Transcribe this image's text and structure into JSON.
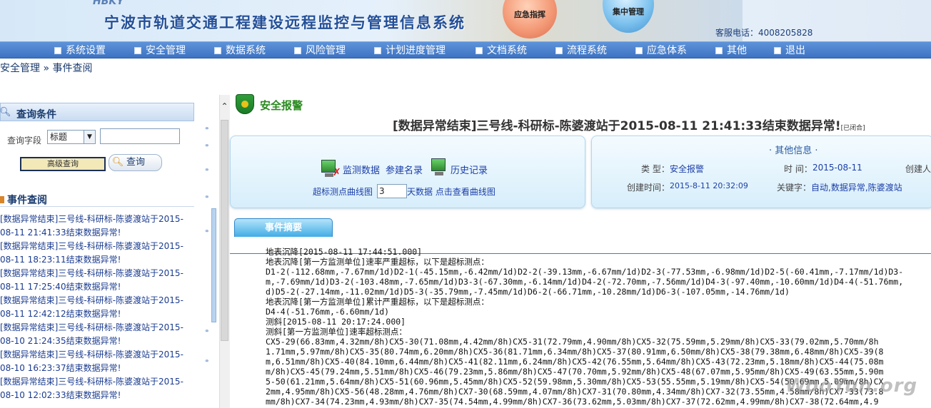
{
  "header": {
    "logo_text": "HBKY",
    "title": "宁波市轨道交通工程建设远程监控与管理信息系统",
    "orb_emergency": "应急指挥",
    "orb_central": "集中管理",
    "hotline": "客服电话：4008205828"
  },
  "nav": [
    "系统设置",
    "安全管理",
    "数据系统",
    "风险管理",
    "计划进度管理",
    "文档系统",
    "流程系统",
    "应急体系",
    "其他",
    "退出"
  ],
  "breadcrumb": "安全管理 » 事件查阅",
  "query": {
    "title": "查询条件",
    "field_label": "查询字段",
    "field_value": "标题",
    "advanced_label": "高级查询",
    "search_label": "查询"
  },
  "events": {
    "title": "事件查阅",
    "items": [
      "[数据异常结束]三号线-科研标-陈婆渡站于2015-08-11 21:41:33结束数据异常!",
      "[数据异常结束]三号线-科研标-陈婆渡站于2015-08-11 18:23:11结束数据异常!",
      "[数据异常结束]三号线-科研标-陈婆渡站于2015-08-11 17:25:40结束数据异常!",
      "[数据异常结束]三号线-科研标-陈婆渡站于2015-08-11 12:42:12结束数据异常!",
      "[数据异常结束]三号线-科研标-陈婆渡站于2015-08-10 21:24:35结束数据异常!",
      "[数据异常结束]三号线-科研标-陈婆渡站于2015-08-10 16:23:37结束数据异常!",
      "[数据异常结束]三号线-科研标-陈婆渡站于2015-08-10 12:02:33结束数据异常!"
    ]
  },
  "alarm": {
    "label": "安全报警",
    "title": "[数据异常结束]三号线-科研标-陈婆渡站于2015-08-11 21:41:33结束数据异常!",
    "closed_tag": "[已闭合]",
    "links": {
      "monitor": "监测数据",
      "params": "参建名录",
      "history": "历史记录",
      "curve": "超标测点曲线图",
      "days": "3",
      "days_suffix": "天数据 点击查看曲线图"
    },
    "other": {
      "title": "· 其他信息 ·",
      "type_label": "类 型：",
      "type_value": "安全报警",
      "time_label": "时 间：",
      "time_value": "2015-08-11",
      "creator_label": "创建人",
      "created_label": "创建时间：",
      "created_value": "2015-8-11 20:32:09",
      "keywords_label": "关键字：",
      "keywords_value": "自动,数据异常,陈婆渡站"
    }
  },
  "tab": {
    "label": "事件摘要"
  },
  "summary": [
    "地表沉降[2015-08-11 17:44:51.000]",
    "地表沉降[第一方监测单位]速率严重超标，以下是超标测点：",
    "D1-2(-112.68mm,-7.67mm/1d)D2-1(-45.15mm,-6.42mm/1d)D2-2(-39.13mm,-6.67mm/1d)D2-3(-77.53mm,-6.98mm/1d)D2-5(-60.41mm,-7.17mm/1d)D3-",
    "m,-7.69mm/1d)D3-2(-103.48mm,-7.65mm/1d)D3-3(-67.30mm,-6.14mm/1d)D4-2(-72.70mm,-7.56mm/1d)D4-3(-97.40mm,-10.60mm/1d)D4-4(-51.76mm,",
    "d)D5-2(-27.14mm,-11.02mm/1d)D5-3(-35.79mm,-7.45mm/1d)D6-2(-66.71mm,-10.28mm/1d)D6-3(-107.05mm,-14.76mm/1d)",
    "地表沉降[第一方监测单位]累计严重超标，以下是超标测点：",
    "D4-4(-51.76mm,-6.60mm/1d)",
    "测斜[2015-08-11 20:17:24.000]",
    "测斜[第一方监测单位]速率超标测点：",
    "CX5-29(66.83mm,4.32mm/8h)CX5-30(71.08mm,4.42mm/8h)CX5-31(72.79mm,4.90mm/8h)CX5-32(75.59mm,5.29mm/8h)CX5-33(79.02mm,5.70mm/8h",
    "1.71mm,5.97mm/8h)CX5-35(80.74mm,6.20mm/8h)CX5-36(81.71mm,6.34mm/8h)CX5-37(80.91mm,6.50mm/8h)CX5-38(79.38mm,6.48mm/8h)CX5-39(8",
    "m,6.51mm/8h)CX5-40(84.10mm,6.44mm/8h)CX5-41(82.11mm,6.24mm/8h)CX5-42(76.55mm,5.64mm/8h)CX5-43(72.23mm,5.18mm/8h)CX5-44(75.08m",
    "m/8h)CX5-45(79.24mm,5.51mm/8h)CX5-46(79.23mm,5.86mm/8h)CX5-47(70.70mm,5.92mm/8h)CX5-48(67.07mm,5.95mm/8h)CX5-49(63.55mm,5.90m",
    "5-50(61.21mm,5.64mm/8h)CX5-51(60.96mm,5.45mm/8h)CX5-52(59.98mm,5.30mm/8h)CX5-53(55.55mm,5.19mm/8h)CX5-54(50.69mm,5.09mm/8h)CX",
    "2mm,4.95mm/8h)CX5-56(48.28mm,4.76mm/8h)CX7-30(68.59mm,4.07mm/8h)CX7-31(70.80mm,4.34mm/8h)CX7-32(73.55mm,4.58mm/8h)CX7-33(73.8",
    "mm/8h)CX7-34(74.23mm,4.93mm/8h)CX7-35(74.54mm,4.99mm/8h)CX7-36(73.62mm,5.03mm/8h)CX7-37(72.62mm,4.99mm/8h)CX7-38(72.64mm,4.9"
  ],
  "watermark": "WooYun.org"
}
